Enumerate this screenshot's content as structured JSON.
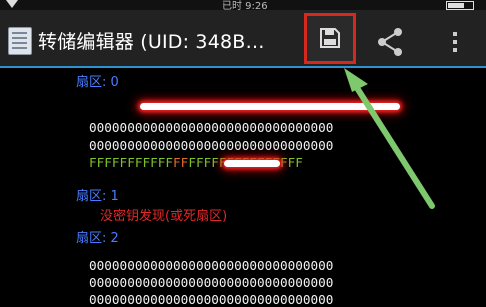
{
  "status_bar": {
    "time": "已时 9:26"
  },
  "action_bar": {
    "title": "转储编辑器 (UID: 348B…",
    "save_label": "save",
    "share_label": "share",
    "overflow_label": "more"
  },
  "sectors": [
    {
      "label": "扇区: 0",
      "rows": [
        "",
        "00000000000000000000000000000000",
        "00000000000000000000000000000000"
      ],
      "trailer": {
        "green_before": "FFFFFFFFFFF",
        "orange": "FF",
        "green_after": "FFFFFFFFFFFFFFF"
      }
    },
    {
      "label": "扇区: 1",
      "error": "没密钥发现(或死扇区)"
    },
    {
      "label": "扇区: 2",
      "rows": [
        "00000000000000000000000000000000",
        "00000000000000000000000000000000",
        "00000000000000000000000000000000"
      ]
    }
  ],
  "colors": {
    "accent": "#2a93d0",
    "sector_label": "#4a7cff",
    "error": "#e0282a",
    "trailer_green": "#7fc12a",
    "trailer_orange": "#e06a2a",
    "highlight_box": "#d5291f",
    "arrow": "#7ec86e"
  },
  "icons": {
    "save": "floppy-disk-icon",
    "share": "share-icon",
    "overflow": "more-vertical-icon",
    "app": "document-icon"
  }
}
